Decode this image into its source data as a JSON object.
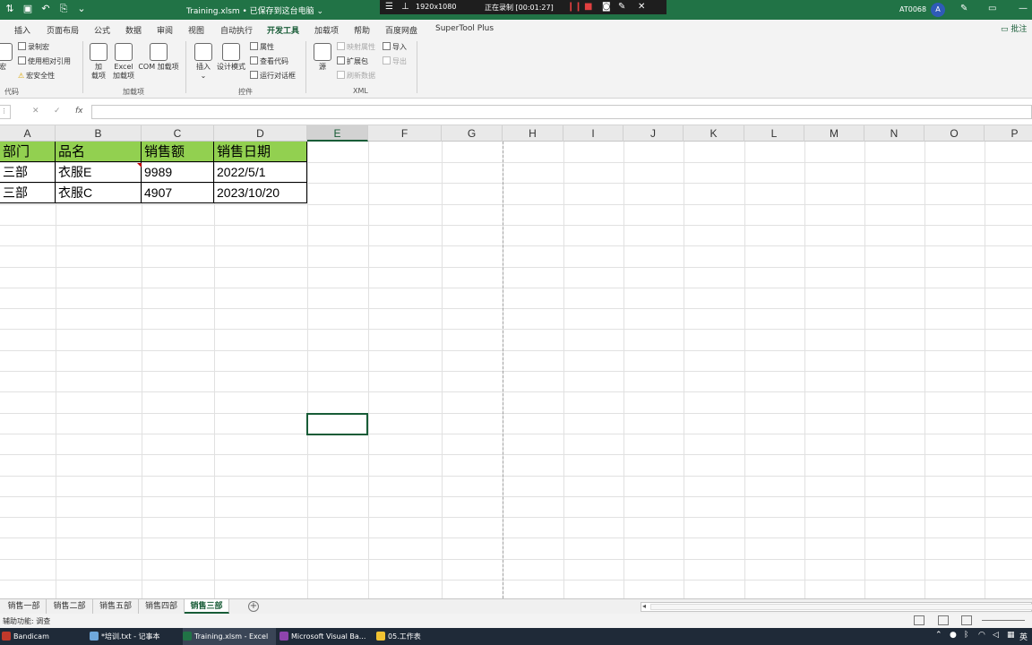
{
  "titlebar": {
    "doc_title": "Training.xlsm • 已保存到这台电脑 ⌄",
    "recorder_resolution": "1920x1080",
    "recorder_status": "正在录制 [00:01:27]",
    "user_id": "AT0068",
    "avatar_letter": "A"
  },
  "ribbon_tabs": [
    "插入",
    "页面布局",
    "公式",
    "数据",
    "审阅",
    "视图",
    "自动执行",
    "开发工具",
    "加载项",
    "帮助",
    "百度网盘",
    "SuperTool Plus"
  ],
  "active_tab": "开发工具",
  "comment_button": "批注",
  "ribbon": {
    "code": {
      "macro_big": "宏",
      "record_macro": "录制宏",
      "relative_ref": "使用相对引用",
      "macro_security": "宏安全性",
      "label": "代码"
    },
    "addins": {
      "addin_line1": "加",
      "addin_line2": "载项",
      "excel_addin_line1": "Excel",
      "excel_addin_line2": "加载项",
      "com_addin": "COM 加载项",
      "label": "加载项"
    },
    "controls": {
      "insert": "插入",
      "design_mode": "设计模式",
      "properties": "属性",
      "view_code": "查看代码",
      "run_dialog": "运行对话框",
      "label": "控件"
    },
    "xml": {
      "source": "源",
      "map_props": "映射属性",
      "expansion_packs": "扩展包",
      "refresh_data": "刷新数据",
      "import": "导入",
      "export": "导出",
      "label": "XML"
    }
  },
  "formula_bar": {
    "cancel": "✕",
    "enter": "✓",
    "fx": "fx",
    "value": ""
  },
  "columns": [
    "A",
    "B",
    "C",
    "D",
    "E",
    "F",
    "G",
    "H",
    "I",
    "J",
    "K",
    "L",
    "M",
    "N",
    "O",
    "P"
  ],
  "selected_column": "E",
  "table": {
    "headers": [
      "部门",
      "品名",
      "销售额",
      "销售日期"
    ],
    "rows": [
      [
        "三部",
        "衣服E",
        "9989",
        "2022/5/1"
      ],
      [
        "三部",
        "衣服C",
        "4907",
        "2023/10/20"
      ]
    ]
  },
  "sheets": [
    "销售一部",
    "销售二部",
    "销售五部",
    "销售四部",
    "销售三部"
  ],
  "active_sheet": "销售三部",
  "statusbar": {
    "text": "辅助功能: 调查"
  },
  "taskbar": [
    {
      "label": "Bandicam",
      "color": "#c0392b"
    },
    {
      "label": "*培训.txt - 记事本",
      "color": "#6fa8dc"
    },
    {
      "label": "Training.xlsm - Excel",
      "color": "#217346"
    },
    {
      "label": "Microsoft Visual Ba...",
      "color": "#8e44ad"
    },
    {
      "label": "05.工作表",
      "color": "#f1c232"
    }
  ],
  "tray": {
    "ime": "英"
  }
}
